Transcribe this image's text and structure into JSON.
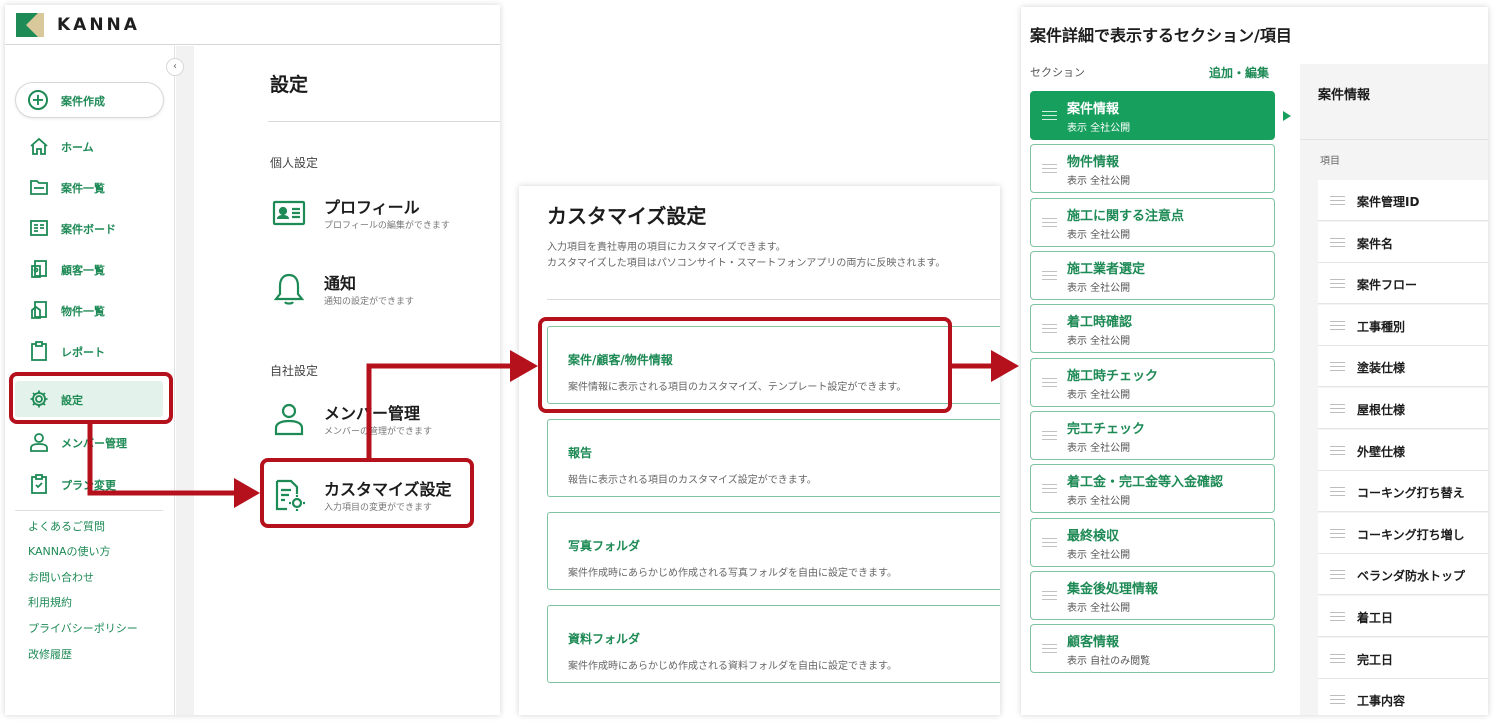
{
  "app": {
    "logo_text": "KANNA",
    "collapse_glyph": "‹",
    "create_button": "案件作成",
    "nav": [
      {
        "label": "ホーム",
        "icon": "home-icon"
      },
      {
        "label": "案件一覧",
        "icon": "folder-icon"
      },
      {
        "label": "案件ボード",
        "icon": "board-icon"
      },
      {
        "label": "顧客一覧",
        "icon": "customer-icon"
      },
      {
        "label": "物件一覧",
        "icon": "building-icon"
      },
      {
        "label": "レポート",
        "icon": "clipboard-icon"
      },
      {
        "label": "設定",
        "icon": "gear-icon"
      },
      {
        "label": "メンバー管理",
        "icon": "person-icon"
      },
      {
        "label": "プラン変更",
        "icon": "clipboard-check-icon"
      }
    ],
    "links": [
      "よくあるご質問",
      "KANNAの使い方",
      "お問い合わせ",
      "利用規約",
      "プライバシーポリシー",
      "改修履歴"
    ],
    "settings": {
      "title": "設定",
      "personal_label": "個人設定",
      "company_label": "自社設定",
      "profile": {
        "title": "プロフィール",
        "sub": "プロフィールの編集ができます"
      },
      "notify": {
        "title": "通知",
        "sub": "通知の設定ができます"
      },
      "member": {
        "title": "メンバー管理",
        "sub": "メンバーの管理ができます"
      },
      "customize": {
        "title": "カスタマイズ設定",
        "sub": "入力項目の変更ができます"
      }
    }
  },
  "customize": {
    "title": "カスタマイズ設定",
    "desc_line1": "入力項目を貴社専用の項目にカスタマイズできます。",
    "desc_line2": "カスタマイズした項目はパソコンサイト・スマートフォンアプリの両方に反映されます。",
    "cards": [
      {
        "title": "案件/顧客/物件情報",
        "sub": "案件情報に表示される項目のカスタマイズ、テンプレート設定ができます。"
      },
      {
        "title": "報告",
        "sub": "報告に表示される項目のカスタマイズ設定ができます。"
      },
      {
        "title": "写真フォルダ",
        "sub": "案件作成時にあらかじめ作成される写真フォルダを自由に設定できます。"
      },
      {
        "title": "資料フォルダ",
        "sub": "案件作成時にあらかじめ作成される資料フォルダを自由に設定できます。"
      }
    ]
  },
  "sections_panel": {
    "title": "案件詳細で表示するセクション/項目",
    "section_label": "セクション",
    "edit_link": "追加・編集",
    "sections": [
      {
        "title": "案件情報",
        "sub": "表示  全社公開"
      },
      {
        "title": "物件情報",
        "sub": "表示  全社公開"
      },
      {
        "title": "施工に関する注意点",
        "sub": "表示  全社公開"
      },
      {
        "title": "施工業者選定",
        "sub": "表示  全社公開"
      },
      {
        "title": "着工時確認",
        "sub": "表示  全社公開"
      },
      {
        "title": "施工時チェック",
        "sub": "表示  全社公開"
      },
      {
        "title": "完工チェック",
        "sub": "表示  全社公開"
      },
      {
        "title": "着工金・完工金等入金確認",
        "sub": "表示  全社公開"
      },
      {
        "title": "最終検収",
        "sub": "表示  全社公開"
      },
      {
        "title": "集金後処理情報",
        "sub": "表示  全社公開"
      },
      {
        "title": "顧客情報",
        "sub": "表示  自社のみ閲覧"
      }
    ],
    "detail_title": "案件情報",
    "items_label": "項目",
    "items": [
      "案件管理ID",
      "案件名",
      "案件フロー",
      "工事種別",
      "塗装仕様",
      "屋根仕様",
      "外壁仕様",
      "コーキング打ち替え",
      "コーキング打ち増し",
      "ベランダ防水トップ",
      "着工日",
      "完工日",
      "工事内容"
    ]
  },
  "colors": {
    "brand_green": "#1e8a55",
    "active_green": "#17a05d",
    "highlight_red": "#b5111d"
  }
}
